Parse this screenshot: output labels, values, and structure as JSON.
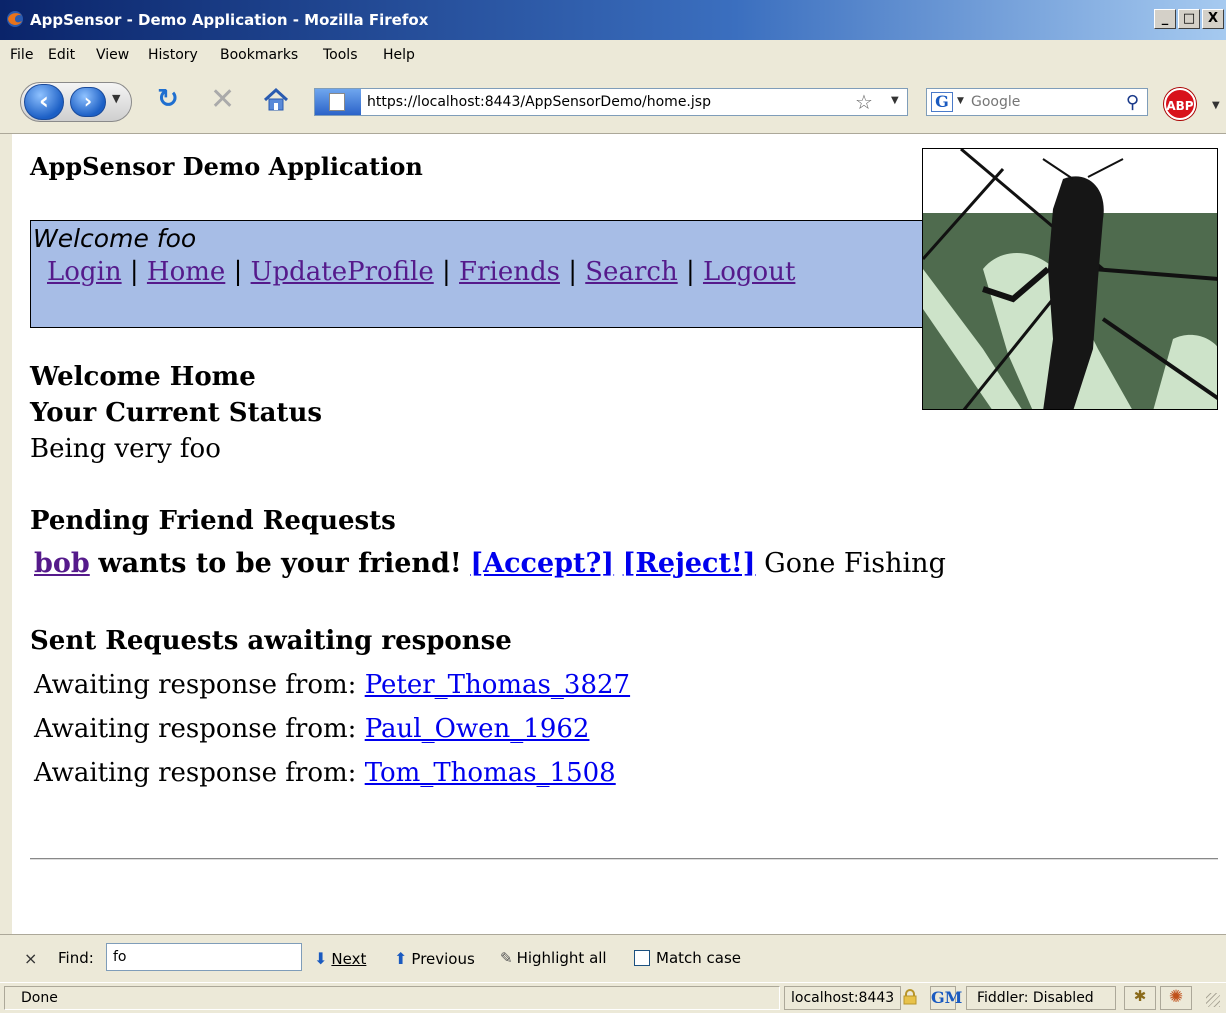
{
  "window": {
    "title": "AppSensor - Demo Application - Mozilla Firefox",
    "controls": {
      "minimize": "_",
      "maximize": "□",
      "close": "X"
    }
  },
  "menubar": {
    "items": [
      "File",
      "Edit",
      "View",
      "History",
      "Bookmarks",
      "Tools",
      "Help"
    ]
  },
  "toolbar": {
    "url": "https://localhost:8443/AppSensorDemo/home.jsp",
    "search_placeholder": "Google",
    "search_engine_icon": "G",
    "adblock_label": "ABP"
  },
  "page": {
    "app_title": "AppSensor Demo Application",
    "welcome_user": "Welcome foo",
    "nav_links": [
      "Login",
      "Home",
      "UpdateProfile",
      "Friends",
      "Search",
      "Logout"
    ],
    "welcome_heading": "Welcome Home",
    "status_heading": "Your Current Status",
    "status_text": "Being very foo",
    "pending_heading": "Pending Friend Requests",
    "pending": {
      "user": "bob",
      "message": "wants to be your friend!",
      "accept": "[Accept?]",
      "reject": "[Reject!]",
      "user_status": "Gone Fishing"
    },
    "sent_heading": "Sent Requests awaiting response",
    "sent_label": "Awaiting response from:",
    "sent_users": [
      "Peter_Thomas_3827",
      "Paul_Owen_1962",
      "Tom_Thomas_1508"
    ]
  },
  "findbar": {
    "close": "×",
    "label": "Find:",
    "query": "fo",
    "next": "Next",
    "previous": "Previous",
    "highlight_all": "Highlight all",
    "match_case": "Match case"
  },
  "statusbar": {
    "status": "Done",
    "host": "localhost:8443",
    "gm_icon": "GM",
    "fiddler": "Fiddler: Disabled"
  },
  "colors": {
    "nav_box_bg": "#a7bde6",
    "visited_link": "#551a8b",
    "link": "#0000ee",
    "mantis_green": "#4f6b4e",
    "mantis_light": "#cde3c9"
  }
}
